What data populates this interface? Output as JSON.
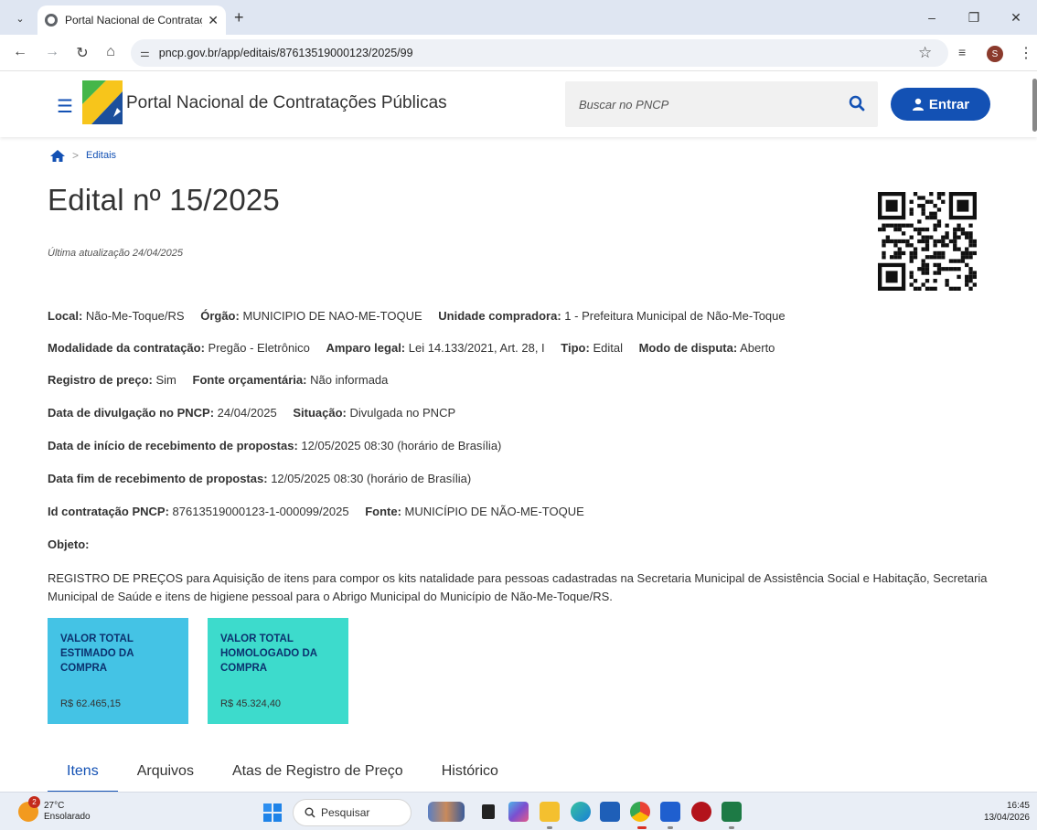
{
  "browser": {
    "tab_title": "Portal Nacional de Contratações",
    "url": "pncp.gov.br/app/editais/87613519000123/2025/99",
    "profile_initial": "S"
  },
  "site": {
    "title": "Portal Nacional de Contratações Públicas",
    "search_placeholder": "Buscar no PNCP",
    "login_label": "Entrar",
    "brand_color": "#1351b4"
  },
  "breadcrumb": {
    "current": "Editais"
  },
  "edital": {
    "title": "Edital nº 15/2025",
    "updated": "Última atualização 24/04/2025",
    "rows": [
      [
        {
          "label": "Local:",
          "value": "Não-Me-Toque/RS"
        },
        {
          "label": "Órgão:",
          "value": "MUNICIPIO DE NAO-ME-TOQUE"
        },
        {
          "label": "Unidade compradora:",
          "value": "1 - Prefeitura Municipal de Não-Me-Toque"
        }
      ],
      [
        {
          "label": "Modalidade da contratação:",
          "value": "Pregão - Eletrônico"
        },
        {
          "label": "Amparo legal:",
          "value": "Lei 14.133/2021, Art. 28, I"
        },
        {
          "label": "Tipo:",
          "value": "Edital"
        },
        {
          "label": "Modo de disputa:",
          "value": "Aberto"
        }
      ],
      [
        {
          "label": "Registro de preço:",
          "value": "Sim"
        },
        {
          "label": "Fonte orçamentária:",
          "value": "Não informada"
        }
      ],
      [
        {
          "label": "Data de divulgação no PNCP:",
          "value": "24/04/2025"
        },
        {
          "label": "Situação:",
          "value": "Divulgada no PNCP"
        }
      ],
      [
        {
          "label": "Data de início de recebimento de propostas:",
          "value": "12/05/2025 08:30 (horário de Brasília)"
        }
      ],
      [
        {
          "label": "Data fim de recebimento de propostas:",
          "value": "12/05/2025 08:30 (horário de Brasília)"
        }
      ],
      [
        {
          "label": "Id contratação PNCP:",
          "value": "87613519000123-1-000099/2025"
        },
        {
          "label": "Fonte:",
          "value": "MUNICÍPIO DE NÃO-ME-TOQUE"
        }
      ],
      [
        {
          "label": "Objeto:",
          "value": ""
        }
      ]
    ],
    "objeto": "REGISTRO DE PREÇOS para Aquisição de itens para compor os kits natalidade para pessoas cadastradas na Secretaria Municipal de Assistência Social e Habitação, Secretaria Municipal de Saúde e itens de higiene pessoal para o Abrigo Municipal do Município de Não-Me-Toque/RS."
  },
  "cards": [
    {
      "label": "VALOR TOTAL ESTIMADO DA COMPRA",
      "value": "R$ 62.465,15",
      "color": "#44c3e5"
    },
    {
      "label": "VALOR TOTAL HOMOLOGADO DA COMPRA",
      "value": "R$ 45.324,40",
      "color": "#3ddbcc"
    }
  ],
  "tabs": [
    "Itens",
    "Arquivos",
    "Atas de Registro de Preço",
    "Histórico"
  ],
  "taskbar": {
    "weather_badge": "2",
    "temperature": "27°C",
    "weather": "Ensolarado",
    "search_label": "Pesquisar",
    "time": "16:45",
    "date": "13/04/2026"
  }
}
